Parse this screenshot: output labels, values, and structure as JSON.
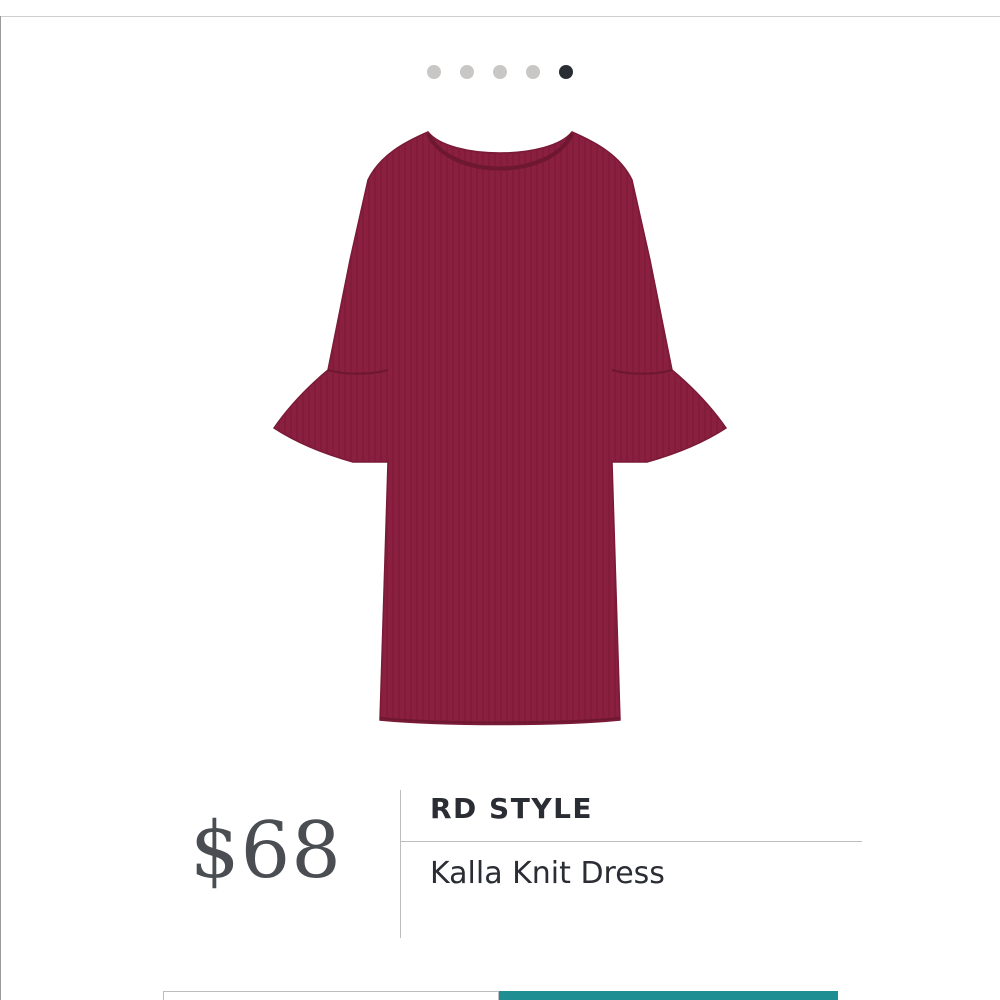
{
  "carousel": {
    "dot_count": 5,
    "active_index": 4
  },
  "product": {
    "price": "$68",
    "brand": "RD STYLE",
    "name": "Kalla Knit Dress",
    "garment_color": "#8a1f3f"
  },
  "colors": {
    "accent": "#1f8e93",
    "text_dark": "#2a2d33",
    "price_text": "#4a4d52",
    "dot_inactive": "#c9c7c5",
    "dot_active": "#2a2d33"
  }
}
